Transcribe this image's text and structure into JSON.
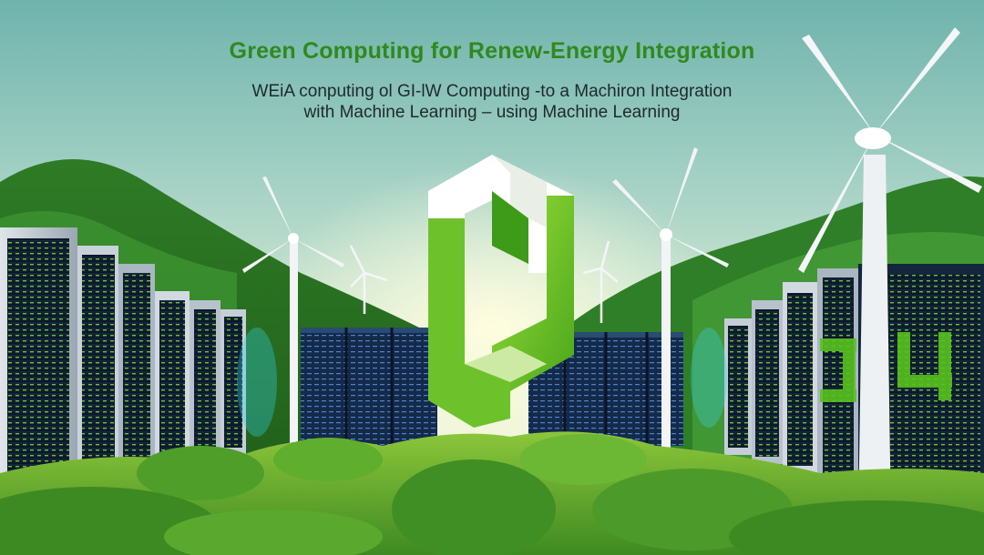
{
  "headline": {
    "title": "Green Computing for Renew-Energy Integration",
    "subtitle_line1": "WEiA conputing ol GI-lW Computing -to a Machiron Integration",
    "subtitle_line2": "with Machine Learning – using Machine Learning"
  },
  "colors": {
    "title_green": "#2f8a1c",
    "sky_top": "#6fb3ad",
    "sky_bottom": "#f2f6d8",
    "grass": "#5fae2e",
    "server_dark": "#0f1d33",
    "server_led": "#7cdc3b"
  }
}
